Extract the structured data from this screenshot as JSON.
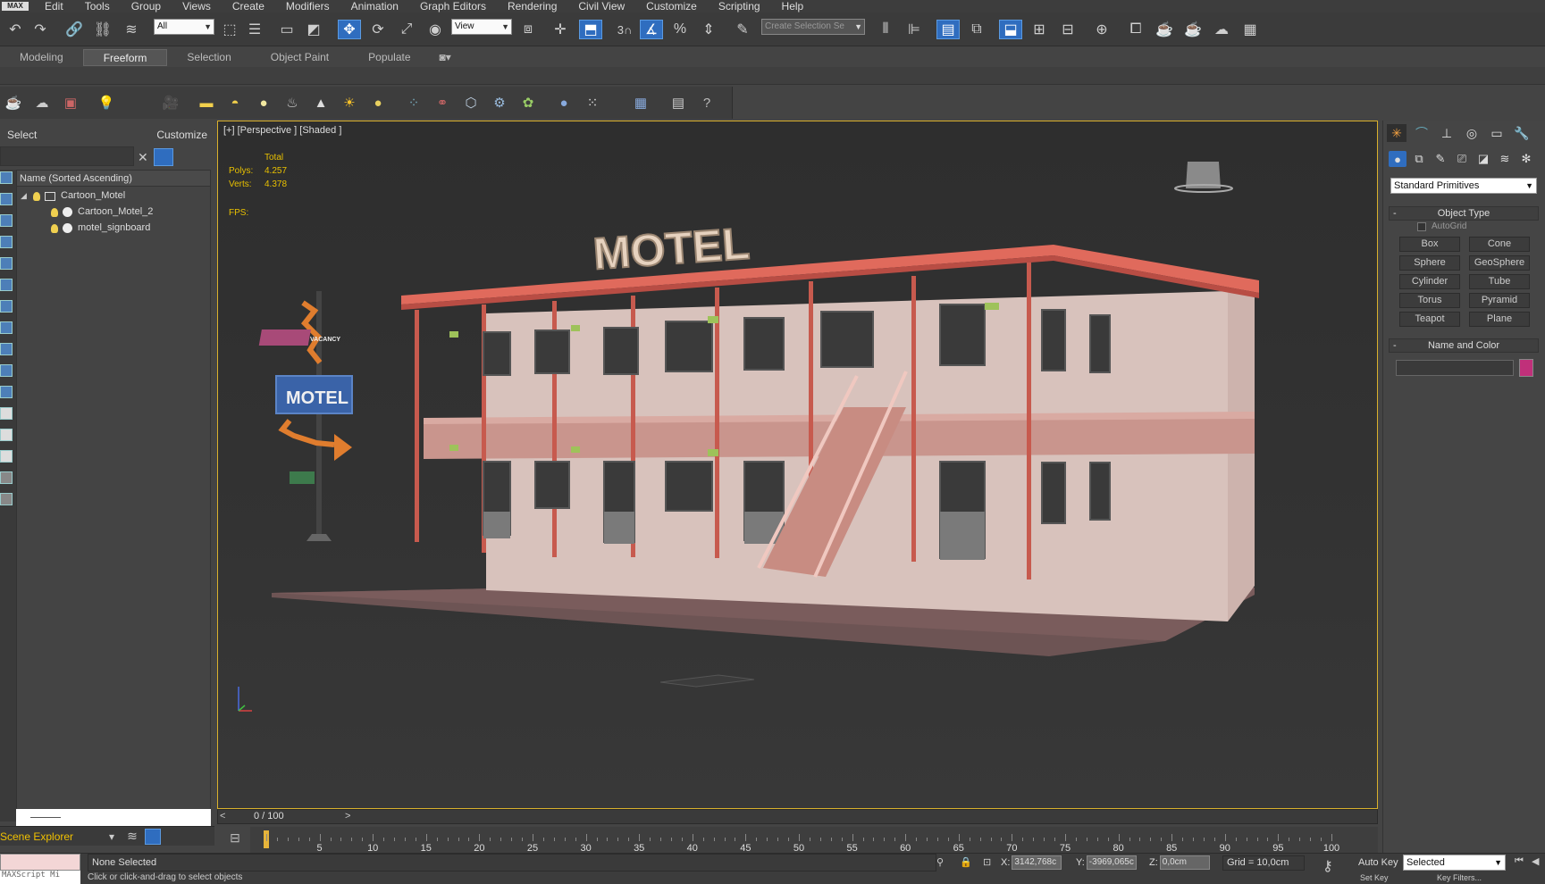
{
  "menubar": {
    "logo": "MAX",
    "items": [
      "Edit",
      "Tools",
      "Group",
      "Views",
      "Create",
      "Modifiers",
      "Animation",
      "Graph Editors",
      "Rendering",
      "Civil View",
      "Customize",
      "Scripting",
      "Help"
    ]
  },
  "toolbar": {
    "filter_value": "All",
    "ref_coord_value": "View",
    "snap_label": "3",
    "named_selection_placeholder": "Create Selection Se"
  },
  "ribbon": {
    "tabs": [
      "Modeling",
      "Freeform",
      "Selection",
      "Object Paint",
      "Populate"
    ],
    "active_tab": "Freeform"
  },
  "scene_explorer": {
    "select_label": "Select",
    "customize_label": "Customize",
    "column_header": "Name (Sorted Ascending)",
    "nodes": [
      "Cartoon_Motel",
      "Cartoon_Motel_2",
      "motel_signboard"
    ],
    "footer_label": "Scene Explorer"
  },
  "viewport": {
    "label": "[+] [Perspective ] [Shaded ]",
    "stats_header": "Total",
    "polys_label": "Polys:",
    "polys_value": "4.257",
    "verts_label": "Verts:",
    "verts_value": "4.378",
    "fps_label": "FPS:",
    "roof_sign_text": "MOTEL",
    "pole_sign_text": "MOTEL",
    "vacancy_text": "VACANCY"
  },
  "command_panel": {
    "category": "Standard Primitives",
    "object_type_title": "Object Type",
    "autogrid_label": "AutoGrid",
    "primitives": [
      "Box",
      "Cone",
      "Sphere",
      "GeoSphere",
      "Cylinder",
      "Tube",
      "Torus",
      "Pyramid",
      "Teapot",
      "Plane"
    ],
    "name_color_title": "Name and Color",
    "swatch_color": "#c0307a"
  },
  "time_slider": {
    "frame_display": "0 / 100",
    "prev": "<",
    "next": ">",
    "ticks": [
      "5",
      "10",
      "15",
      "20",
      "25",
      "30",
      "35",
      "40",
      "45",
      "50",
      "55",
      "60",
      "65",
      "70",
      "75",
      "80",
      "85",
      "90",
      "95",
      "100"
    ]
  },
  "status": {
    "maxscript_label": "MAXScript Mi",
    "selection_status": "None Selected",
    "hint": "Click or click-and-drag to select objects",
    "x_label": "X:",
    "x_value": "3142,768c",
    "y_label": "Y:",
    "y_value": "-3969,065c",
    "z_label": "Z:",
    "z_value": "0,0cm",
    "grid": "Grid = 10,0cm",
    "auto_key": "Auto Key",
    "selected_value": "Selected",
    "set_key": "Set Key",
    "key_filters": "Key Filters..."
  },
  "colors": {
    "accent": "#2f6dbf",
    "viewport_border": "#d9b02c",
    "stats_text": "#e8c000",
    "roof": "#e06a5c",
    "walls": "#d9c3bd"
  }
}
